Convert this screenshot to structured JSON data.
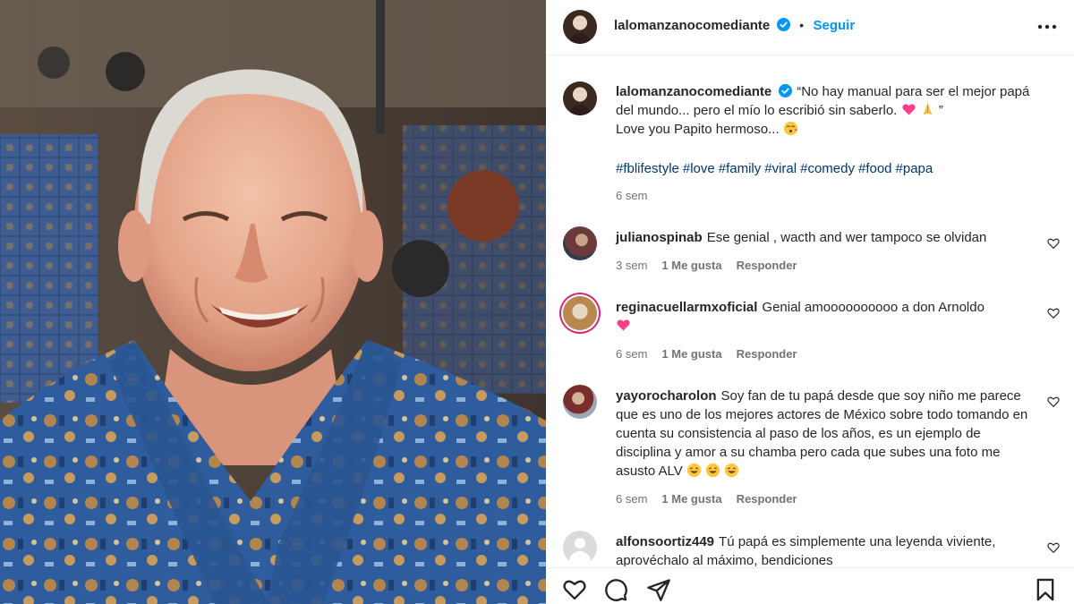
{
  "post": {
    "author": "lalomanzanocomediante",
    "follow_label": "Seguir",
    "bullet": "•",
    "more_icon": "more-horizontal-icon",
    "caption_text": "“No hay manual para ser el mejor papá del mundo... pero el mío lo escribió sin saberlo.",
    "caption_close": "”",
    "caption_line2": "Love you Papito hermoso...",
    "hashtags": [
      "#fblifestyle",
      "#love",
      "#family",
      "#viral",
      "#comedy",
      "#food",
      "#papa"
    ],
    "time": "6 sem"
  },
  "comments": [
    {
      "user": "julianospinab",
      "text": "Ese genial , wacth and wer tampoco se olvidan",
      "time": "3 sem",
      "likes": "1 Me gusta",
      "reply": "Responder"
    },
    {
      "user": "reginacuellarmxoficial",
      "text": "Genial amoooooooooo a don Arnoldo",
      "time": "6 sem",
      "likes": "1 Me gusta",
      "reply": "Responder"
    },
    {
      "user": "yayorocharolon",
      "text": "Soy fan de tu papá desde que soy niño me parece que es uno de los mejores actores de México sobre todo tomando en cuenta su consistencia al paso de los años, es un ejemplo de disciplina y amor a su chamba pero cada que subes una foto me asusto ALV",
      "time": "6 sem",
      "likes": "1 Me gusta",
      "reply": "Responder"
    },
    {
      "user": "alfonsoortiz449",
      "text": "Tú papá es simplemente una leyenda viviente, aprovéchalo al máximo, bendiciones"
    }
  ],
  "action_icons": [
    "heart-icon",
    "comment-icon",
    "share-icon",
    "bookmark-icon"
  ],
  "colors": {
    "link_blue": "#0095f6",
    "hashtag": "#00376b",
    "muted": "#737373",
    "heart_pink": "#ff3e8a"
  }
}
